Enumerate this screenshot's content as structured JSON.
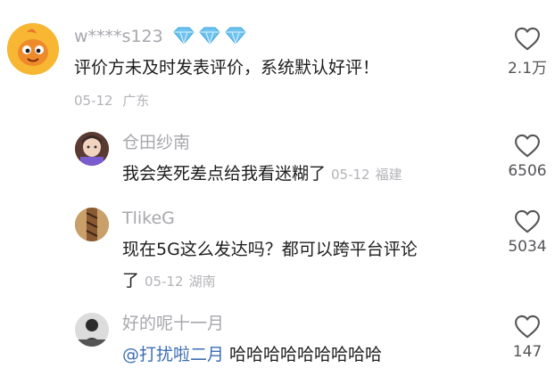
{
  "comments": [
    {
      "username": "w****s123",
      "text": "评价方未及时发表评价，系统默认好评！",
      "date": "05-12",
      "location": "广东",
      "likes": "2.1万",
      "badge_count": 3
    },
    {
      "username": "仓田纱南",
      "text": "我会笑死差点给我看迷糊了",
      "date": "05-12",
      "location": "福建",
      "likes": "6506"
    },
    {
      "username": "TlikeG",
      "text_line1": "现在5G这么发达吗？都可以跨平台评论",
      "text_line2": "了",
      "date": "05-12",
      "location": "湖南",
      "likes": "5034"
    },
    {
      "username": "好的呢十一月",
      "mention": "@打扰啦二月",
      "text": "哈哈哈哈哈哈哈哈哈",
      "likes": "147"
    }
  ],
  "colors": {
    "username": "#a7a7ad",
    "meta": "#b3b3b8",
    "text": "#1d1d1f",
    "mention": "#3c6eb4",
    "diamond": "#6fc3ef",
    "avatar_bg": "#f5a623"
  }
}
